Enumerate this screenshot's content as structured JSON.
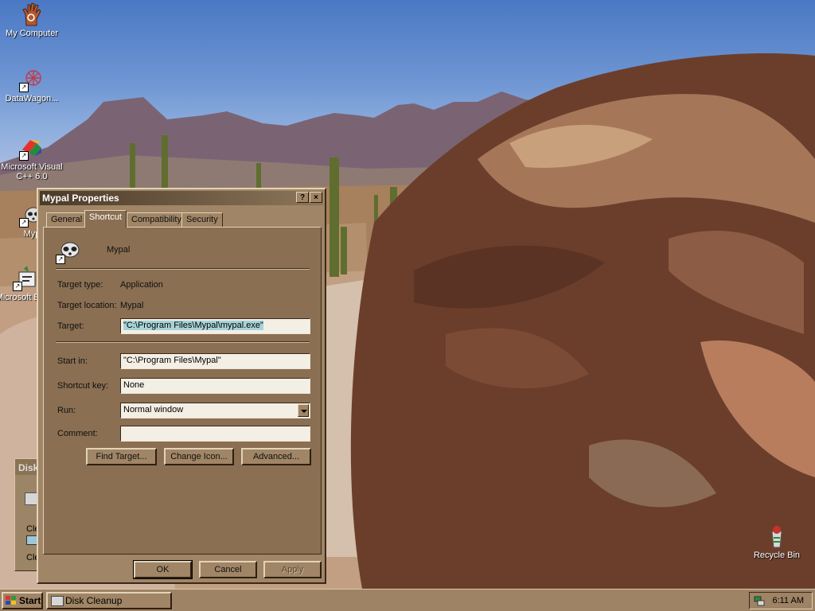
{
  "desktop": {
    "icons": [
      {
        "label": "My Computer"
      },
      {
        "label": "DataWagon..."
      },
      {
        "label": "Microsoft Visual C++ 6.0"
      },
      {
        "label": "Myp"
      },
      {
        "label": "Microsoft Basic"
      },
      {
        "label": "Recycle Bin"
      }
    ]
  },
  "background_window": {
    "title": "Disk",
    "row1": "Cle",
    "row2": "Cle"
  },
  "dialog": {
    "title": "Mypal Properties",
    "help_button": "?",
    "close_button": "×",
    "tabs": [
      {
        "label": "General"
      },
      {
        "label": "Shortcut"
      },
      {
        "label": "Compatibility"
      },
      {
        "label": "Security"
      }
    ],
    "active_tab": "Shortcut",
    "shortcut_name": "Mypal",
    "target_type_label": "Target type:",
    "target_type_value": "Application",
    "target_location_label": "Target location:",
    "target_location_value": "Mypal",
    "target_label": "Target:",
    "target_value": "\"C:\\Program Files\\Mypal\\mypal.exe\"",
    "start_in_label": "Start in:",
    "start_in_value": "\"C:\\Program Files\\Mypal\"",
    "shortcut_key_label": "Shortcut key:",
    "shortcut_key_value": "None",
    "run_label": "Run:",
    "run_value": "Normal window",
    "comment_label": "Comment:",
    "comment_value": "",
    "find_target_button": "Find Target...",
    "change_icon_button": "Change Icon...",
    "advanced_button": "Advanced...",
    "ok_button": "OK",
    "cancel_button": "Cancel",
    "apply_button": "Apply"
  },
  "taskbar": {
    "start_label": "Start",
    "tasks": [
      {
        "label": "Disk Cleanup"
      }
    ],
    "clock": "6:11 AM"
  }
}
